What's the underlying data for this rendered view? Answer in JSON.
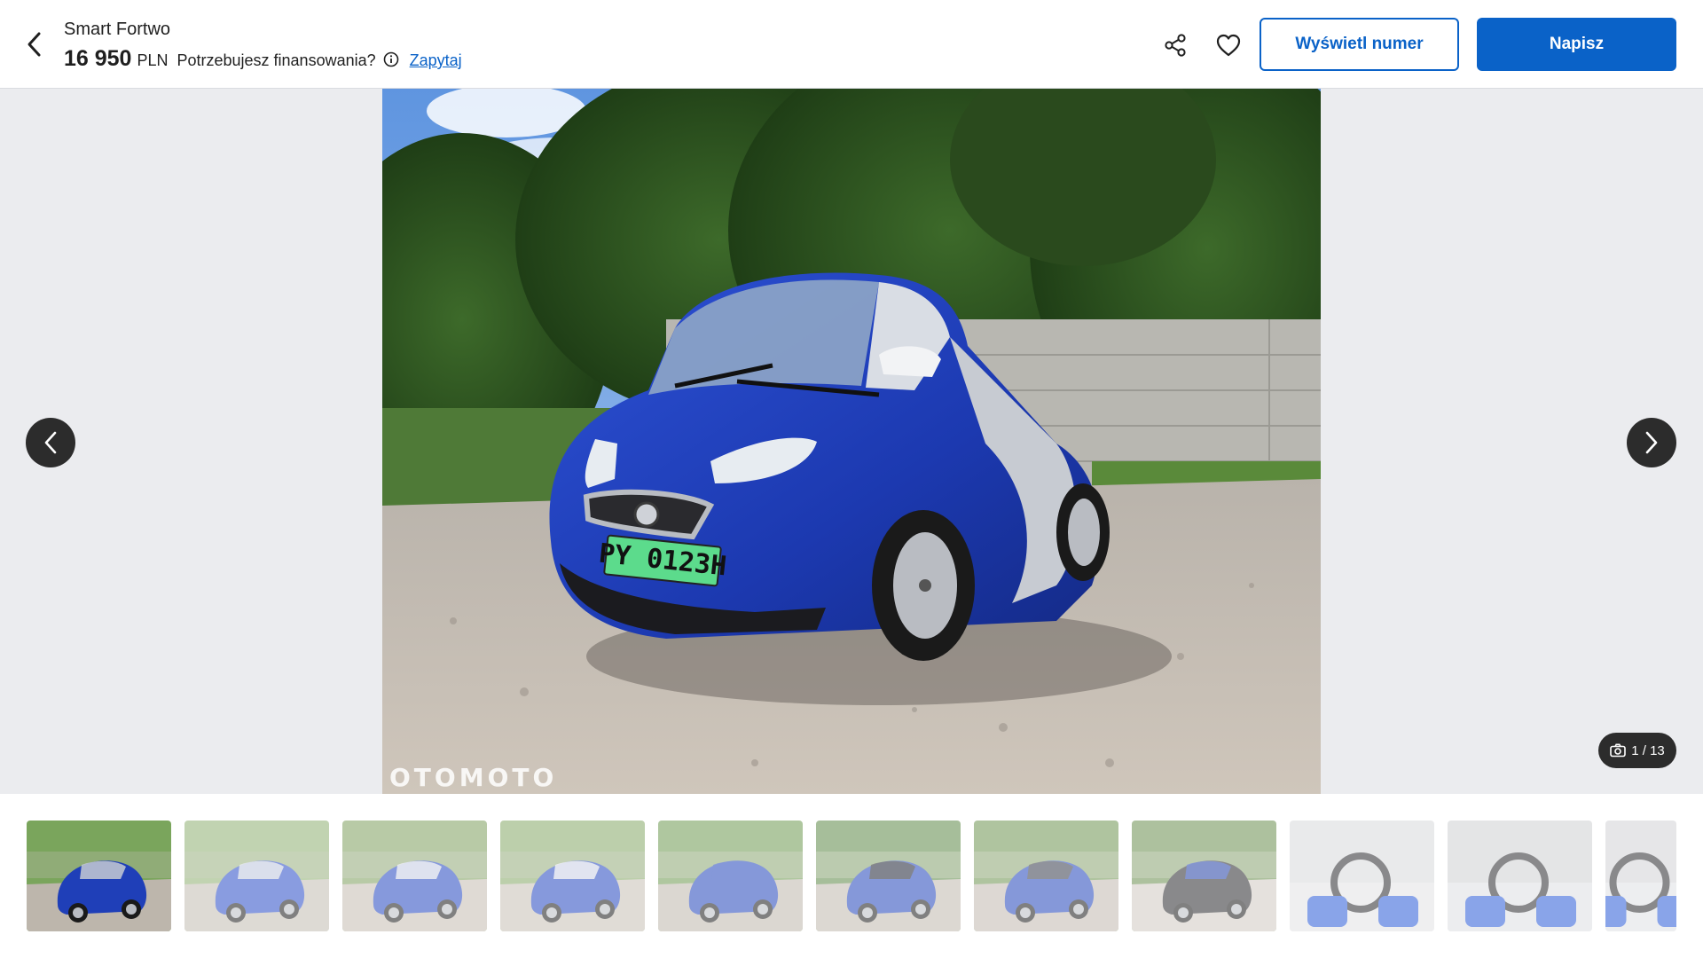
{
  "header": {
    "title": "Smart Fortwo",
    "price": "16 950",
    "currency": "PLN",
    "finance_question": "Potrzebujesz finansowania?",
    "ask_link": "Zapytaj",
    "show_number_label": "Wyświetl numer",
    "write_label": "Napisz"
  },
  "gallery": {
    "watermark": "OTOMOTO",
    "current_index": 1,
    "total": 13,
    "counter_text": "1 / 13",
    "thumbnails": [
      {
        "label": "front three-quarter",
        "active": true
      },
      {
        "label": "front three-quarter 2",
        "active": false
      },
      {
        "label": "side left",
        "active": false
      },
      {
        "label": "rear three-quarter",
        "active": false
      },
      {
        "label": "rear",
        "active": false
      },
      {
        "label": "rear open",
        "active": false
      },
      {
        "label": "trunk",
        "active": false
      },
      {
        "label": "trunk interior",
        "active": false
      },
      {
        "label": "interior dashboard",
        "active": false
      },
      {
        "label": "interior front",
        "active": false
      },
      {
        "label": "interior steering",
        "active": false
      }
    ]
  },
  "colors": {
    "brand_blue": "#0a62c8",
    "car_blue": "#1f3fb8",
    "plate_green": "#5cdb8c"
  },
  "icons": [
    "chevron-left-icon",
    "info-icon",
    "share-icon",
    "heart-icon",
    "camera-icon",
    "chevron-right-icon"
  ]
}
